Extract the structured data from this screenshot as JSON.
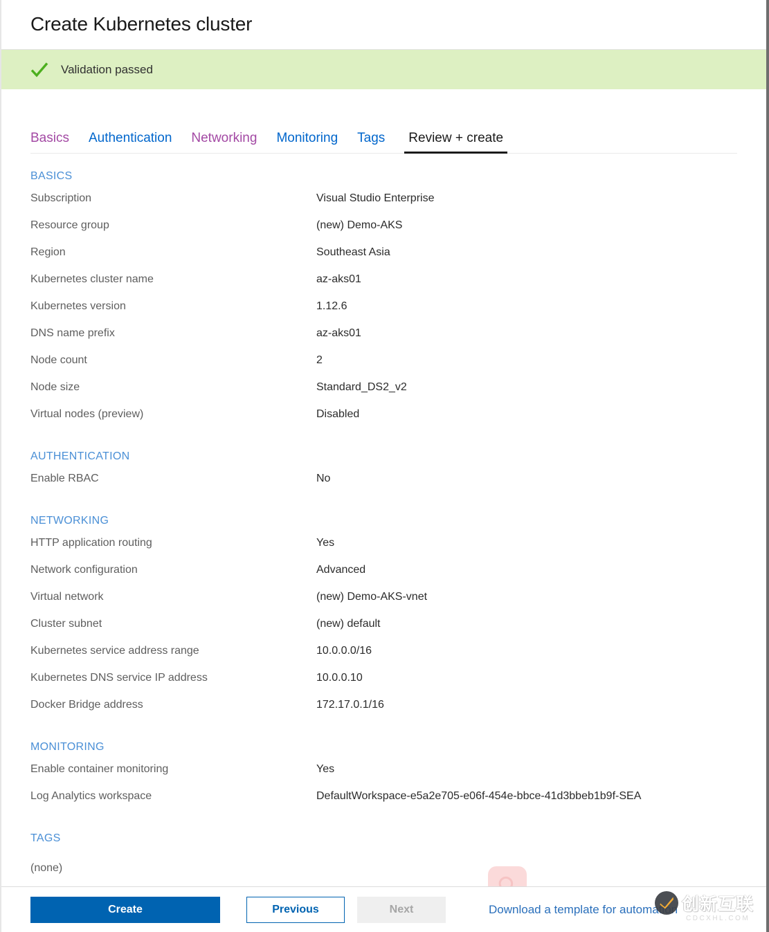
{
  "header": {
    "title": "Create Kubernetes cluster"
  },
  "validation": {
    "icon": "check-icon",
    "message": "Validation passed",
    "banner_color": "#ddf0c2",
    "check_color": "#4caf1e"
  },
  "tabs": [
    {
      "label": "Basics",
      "state": "visited"
    },
    {
      "label": "Authentication",
      "state": "link"
    },
    {
      "label": "Networking",
      "state": "visited"
    },
    {
      "label": "Monitoring",
      "state": "link"
    },
    {
      "label": "Tags",
      "state": "link"
    },
    {
      "label": "Review + create",
      "state": "active"
    }
  ],
  "sections": [
    {
      "heading": "BASICS",
      "rows": [
        {
          "label": "Subscription",
          "value": "Visual Studio Enterprise"
        },
        {
          "label": "Resource group",
          "value": "(new) Demo-AKS"
        },
        {
          "label": "Region",
          "value": "Southeast Asia"
        },
        {
          "label": "Kubernetes cluster name",
          "value": "az-aks01"
        },
        {
          "label": "Kubernetes version",
          "value": "1.12.6"
        },
        {
          "label": "DNS name prefix",
          "value": "az-aks01"
        },
        {
          "label": "Node count",
          "value": "2"
        },
        {
          "label": "Node size",
          "value": "Standard_DS2_v2"
        },
        {
          "label": "Virtual nodes (preview)",
          "value": "Disabled"
        }
      ]
    },
    {
      "heading": "AUTHENTICATION",
      "rows": [
        {
          "label": "Enable RBAC",
          "value": "No"
        }
      ]
    },
    {
      "heading": "NETWORKING",
      "rows": [
        {
          "label": "HTTP application routing",
          "value": "Yes"
        },
        {
          "label": "Network configuration",
          "value": "Advanced"
        },
        {
          "label": "Virtual network",
          "value": "(new) Demo-AKS-vnet"
        },
        {
          "label": "Cluster subnet",
          "value": "(new) default"
        },
        {
          "label": "Kubernetes service address range",
          "value": "10.0.0.0/16"
        },
        {
          "label": "Kubernetes DNS service IP address",
          "value": "10.0.0.10"
        },
        {
          "label": "Docker Bridge address",
          "value": "172.17.0.1/16"
        }
      ]
    },
    {
      "heading": "MONITORING",
      "rows": [
        {
          "label": "Enable container monitoring",
          "value": "Yes"
        },
        {
          "label": "Log Analytics workspace",
          "value": "DefaultWorkspace-e5a2e705-e06f-454e-bbce-41d3bbeb1b9f-SEA"
        }
      ]
    },
    {
      "heading": "TAGS",
      "empty_text": "(none)"
    }
  ],
  "footer": {
    "create_label": "Create",
    "previous_label": "Previous",
    "next_label": "Next",
    "next_disabled": true,
    "download_link": "Download a template for automation",
    "primary_color": "#0063b1",
    "link_color": "#2a6fbb"
  },
  "watermarks": {
    "search_icon": "search-icon",
    "brand_text": "创新互联",
    "brand_sub": "CDCXHL.COM"
  }
}
